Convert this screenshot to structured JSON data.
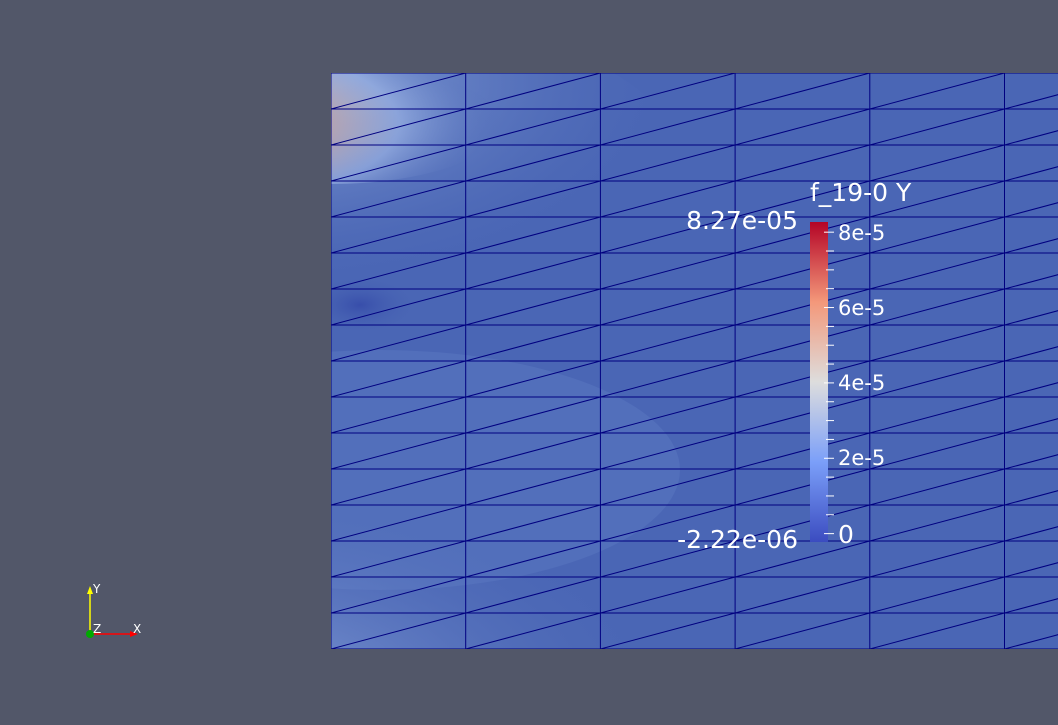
{
  "colorbar": {
    "title": "f_19-0 Y",
    "max_label": "8.27e-05",
    "min_label": "-2.22e-06",
    "range": [
      -2.22e-06,
      8.27e-05
    ],
    "ticks": [
      {
        "value": 8e-05,
        "label": "8e-5"
      },
      {
        "value": 6e-05,
        "label": "6e-5"
      },
      {
        "value": 4e-05,
        "label": "4e-5"
      },
      {
        "value": 2e-05,
        "label": "2e-5"
      },
      {
        "value": 0,
        "label": "0"
      }
    ],
    "colormap": "cool-to-warm",
    "colors": {
      "low": "#3b4cc0",
      "mid": "#dddddd",
      "high": "#b40426"
    }
  },
  "orientation_axes": {
    "y_label": "Y",
    "z_label": "Z",
    "x_label": "X",
    "colors": {
      "x": "#ff0000",
      "y": "#ffff00",
      "z": "#00aa00"
    }
  },
  "mesh": {
    "edge_color": "#000080",
    "base_color": "#4a66b5",
    "hot_spot_color": "#c8413a",
    "columns": 6,
    "rows": 16
  },
  "background_color": "#525769"
}
